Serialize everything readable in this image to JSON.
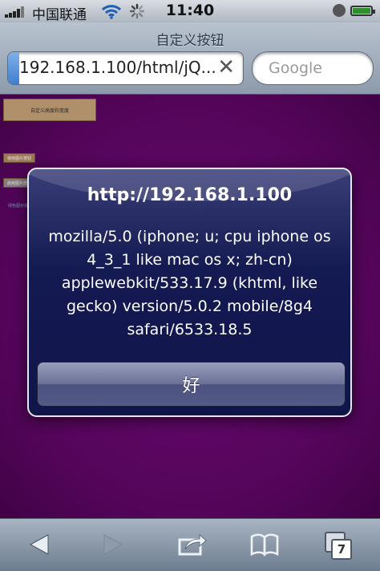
{
  "status_bar": {
    "carrier": "中国联通",
    "time": "11:40"
  },
  "safari": {
    "page_title": "自定义按钮",
    "url": "192.168.1.100/html/jQ...",
    "search_placeholder": "Google"
  },
  "page": {
    "custom_button": "自定义高度和宽度",
    "image_button": "使用图片按钮",
    "enable_button": "启用图片按钮",
    "green_link": "绿色图标按钮"
  },
  "alert": {
    "title": "http://192.168.1.100",
    "message": "mozilla/5.0 (iphone; u; cpu iphone os 4_3_1 like mac os x; zh-cn) applewebkit/533.17.9 (khtml, like gecko) version/5.0.2 mobile/8g4 safari/6533.18.5",
    "ok_label": "好"
  },
  "toolbar": {
    "pages_count": "7"
  },
  "icons": {
    "status": [
      "signal-icon",
      "wifi-icon",
      "loading-spinner-icon",
      "alarm-icon",
      "battery-icon"
    ],
    "toolbar": [
      "back-arrow-icon",
      "forward-arrow-icon",
      "share-icon",
      "bookmarks-icon",
      "pages-icon"
    ]
  },
  "colors": {
    "page_background": "#6a0872",
    "alert_background": "#141a52",
    "toolbar": "#8a98aa"
  }
}
